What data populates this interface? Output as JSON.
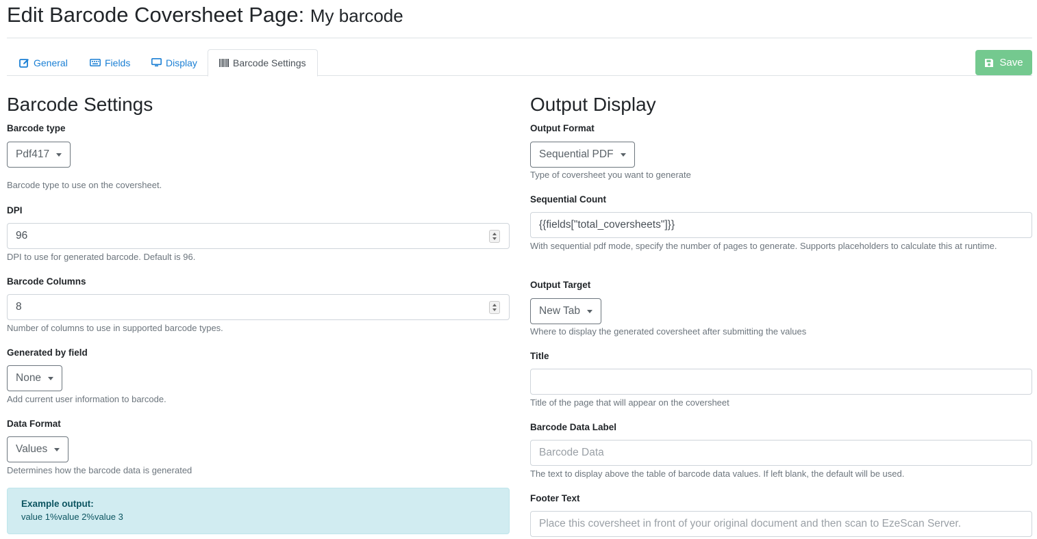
{
  "header": {
    "title": "Edit Barcode Coversheet Page:",
    "subtitle": "My barcode"
  },
  "tabs": [
    {
      "label": "General",
      "icon": "edit-icon"
    },
    {
      "label": "Fields",
      "icon": "keyboard-icon"
    },
    {
      "label": "Display",
      "icon": "monitor-icon"
    },
    {
      "label": "Barcode Settings",
      "icon": "barcode-icon",
      "active": true
    }
  ],
  "toolbar": {
    "save_label": "Save"
  },
  "barcode_settings": {
    "title": "Barcode Settings",
    "barcode_type": {
      "label": "Barcode type",
      "value": "Pdf417",
      "help": "Barcode type to use on the coversheet."
    },
    "dpi": {
      "label": "DPI",
      "value": "96",
      "help": "DPI to use for generated barcode. Default is 96."
    },
    "barcode_columns": {
      "label": "Barcode Columns",
      "value": "8",
      "help": "Number of columns to use in supported barcode types."
    },
    "generated_by_field": {
      "label": "Generated by field",
      "value": "None",
      "help": "Add current user information to barcode."
    },
    "data_format": {
      "label": "Data Format",
      "value": "Values",
      "help": "Determines how the barcode data is generated"
    },
    "example": {
      "title": "Example output:",
      "value": "value 1%value 2%value 3"
    }
  },
  "output_display": {
    "title": "Output Display",
    "output_format": {
      "label": "Output Format",
      "value": "Sequential PDF",
      "help": "Type of coversheet you want to generate"
    },
    "sequential_count": {
      "label": "Sequential Count",
      "value": "{{fields[\"total_coversheets\"]}}",
      "help": "With sequential pdf mode, specify the number of pages to generate. Supports placeholders to calculate this at runtime."
    },
    "output_target": {
      "label": "Output Target",
      "value": "New Tab",
      "help": "Where to display the generated coversheet after submitting the values"
    },
    "title_field": {
      "label": "Title",
      "value": "",
      "help": "Title of the page that will appear on the coversheet"
    },
    "barcode_data_label": {
      "label": "Barcode Data Label",
      "placeholder": "Barcode Data",
      "help": "The text to display above the table of barcode data values. If left blank, the default will be used."
    },
    "footer_text": {
      "label": "Footer Text",
      "placeholder": "Place this coversheet in front of your original document and then scan to EzeScan Server."
    }
  },
  "colors": {
    "link": "#1a7fd4",
    "save_button": "#74c98f",
    "alert_bg": "#d1ecf1",
    "alert_text": "#0c5460"
  }
}
